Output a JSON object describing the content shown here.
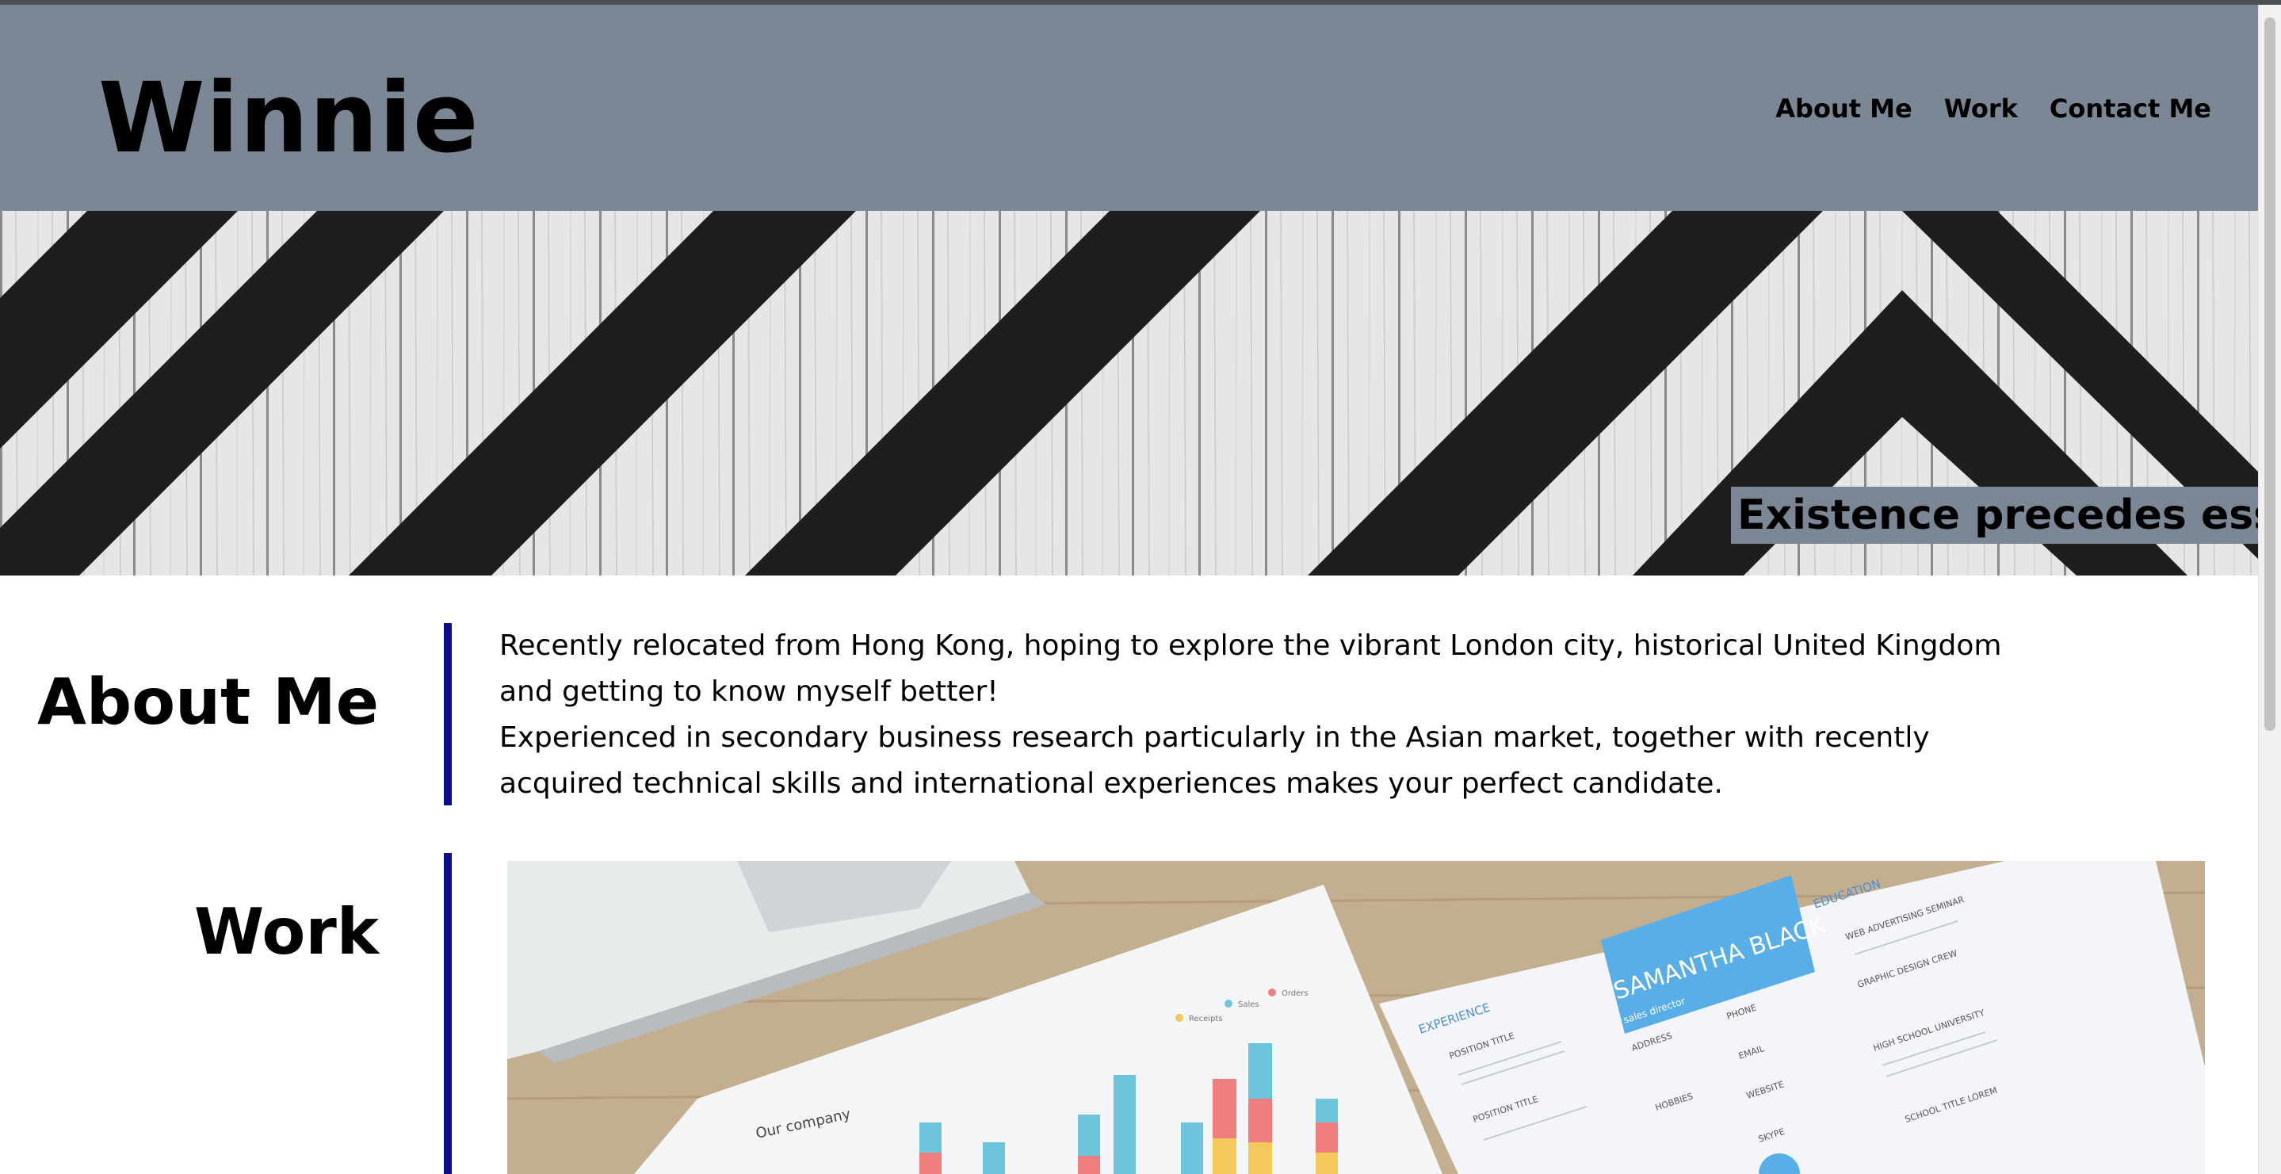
{
  "site": {
    "logo": "Winnie",
    "nav": [
      "About Me",
      "Work",
      "Contact Me"
    ],
    "motto": "Existence precedes essence"
  },
  "about": {
    "heading": "About Me",
    "paragraphs": [
      "Recently relocated from Hong Kong, hoping to explore the vibrant London city, historical United Kingdom and getting to know myself better!",
      "Experienced in secondary business research particularly in the Asian market, together with recently acquired technical skills and international experiences makes your perfect candidate."
    ]
  },
  "work": {
    "heading": "Work",
    "image": {
      "our_company": "Our company",
      "legend": [
        "Receipts",
        "Sales",
        "Orders"
      ],
      "resume_name": "SAMANTHA BLACK",
      "resume_role": "sales director",
      "experience": "EXPERIENCE",
      "education": "EDUCATION",
      "address": "ADDRESS",
      "phone": "PHONE",
      "email": "EMAIL",
      "website": "WEBSITE",
      "hobbies": "HOBBIES",
      "skype": "SKYPE",
      "position_title": "POSITION TITLE",
      "web_seminar": "WEB ADVERTISING SEMINAR",
      "graphic_design": "GRAPHIC DESIGN CREW",
      "high_school": "HIGH SCHOOL UNIVERSITY",
      "school_title": "SCHOOL TITLE LOREM"
    }
  },
  "colors": {
    "header_bg": "#7b8795",
    "accent_bar": "#0d0d8c",
    "page_bg": "#ffffff"
  }
}
